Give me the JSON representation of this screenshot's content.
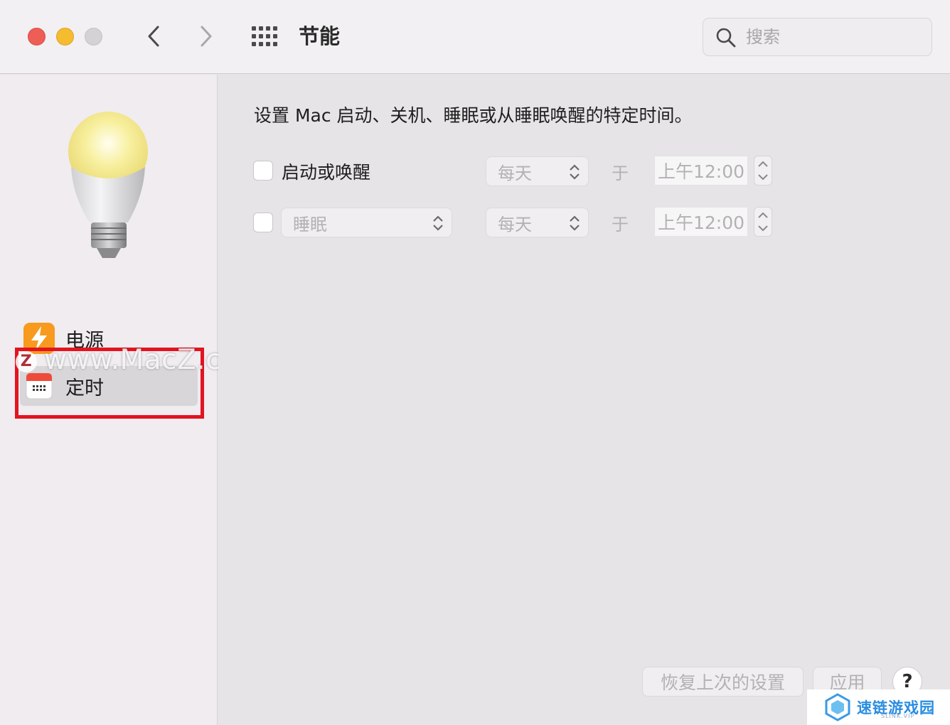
{
  "window": {
    "title": "节能",
    "search_placeholder": "搜索"
  },
  "sidebar": {
    "items": [
      {
        "label": "电源",
        "icon": "lightning-bolt-icon"
      },
      {
        "label": "定时",
        "icon": "calendar-icon",
        "selected": true
      }
    ],
    "watermark": "www.MacZ.com",
    "watermark_logo": "Z"
  },
  "main": {
    "description": "设置 Mac 启动、关机、睡眠或从睡眠唤醒的特定时间。",
    "rows": [
      {
        "checked": false,
        "label": "启动或唤醒",
        "frequency": "每天",
        "at_label": "于",
        "time": "上午12:00"
      },
      {
        "checked": false,
        "action": "睡眠",
        "frequency": "每天",
        "at_label": "于",
        "time": "上午12:00"
      }
    ],
    "buttons": {
      "restore": "恢复上次的设置",
      "apply": "应用",
      "help": "?"
    }
  },
  "badge": {
    "text": "速链游戏园",
    "sub": "SLINK.VIP"
  },
  "colors": {
    "highlight": "#e3131f",
    "close": "#ee5e56",
    "minimize": "#f5bc2f",
    "maximize": "#d4d2d4"
  }
}
